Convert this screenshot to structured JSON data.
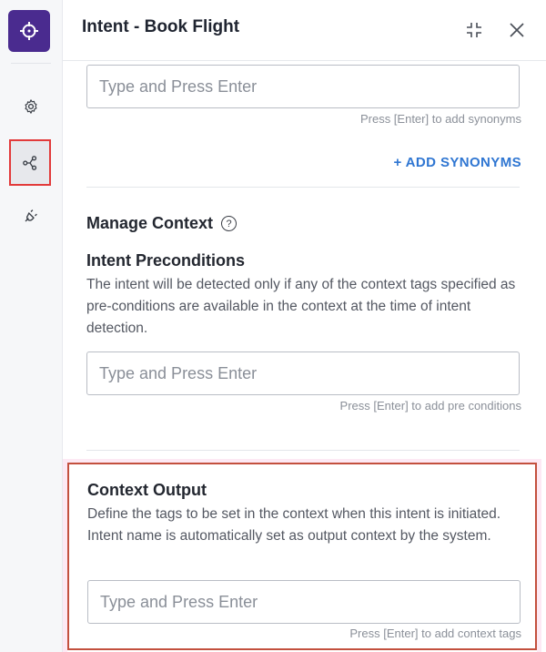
{
  "header": {
    "title": "Intent - Book Flight"
  },
  "synonyms": {
    "input_placeholder": "Type and Press Enter",
    "helper": "Press [Enter] to add synonyms",
    "add_button": "+ ADD SYNONYMS"
  },
  "manage_context": {
    "heading": "Manage Context",
    "help": "?"
  },
  "preconditions": {
    "heading": "Intent Preconditions",
    "description": "The intent will be detected only if any of the context tags specified as pre-conditions are available in the context at the time of intent detection.",
    "input_placeholder": "Type and Press Enter",
    "helper": "Press [Enter] to add pre conditions"
  },
  "context_output": {
    "heading": "Context Output",
    "description": "Define the tags to be set in the context when this intent is initiated. Intent name is automatically set as output context by the system.",
    "input_placeholder": "Type and Press Enter",
    "helper": "Press [Enter] to add context tags"
  },
  "icons": {
    "logo": "crosshair-icon",
    "settings": "gear-icon",
    "flow": "share-nodes-icon",
    "plug": "plug-icon",
    "collapse": "collapse-icon",
    "close": "close-icon"
  },
  "colors": {
    "logo_bg": "#4a2b8f",
    "accent": "#2f76d2",
    "highlight_border": "#c3503e",
    "selected_rail_border": "#e23a3a"
  }
}
